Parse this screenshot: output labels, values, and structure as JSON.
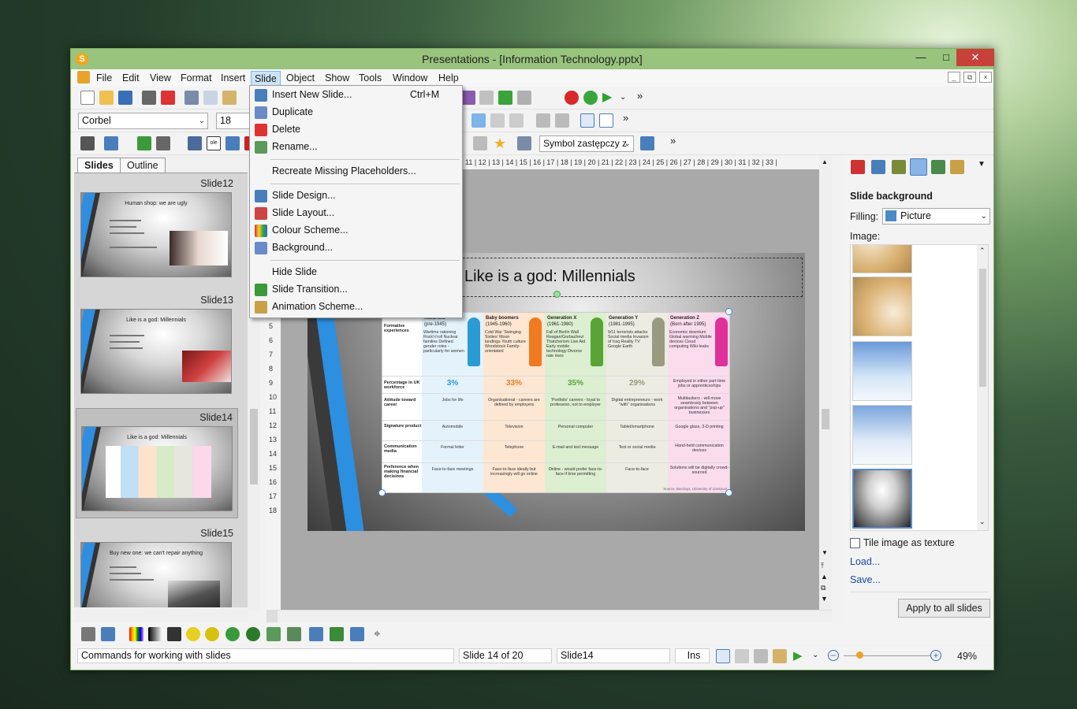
{
  "window": {
    "title": "Presentations - [Information Technology.pptx]",
    "app_badge": "S"
  },
  "menubar": {
    "items": [
      "File",
      "Edit",
      "View",
      "Format",
      "Insert",
      "Slide",
      "Object",
      "Show",
      "Tools",
      "Window",
      "Help"
    ],
    "active": "Slide"
  },
  "toolbar": {
    "font": "Corbel",
    "font_size": "18",
    "symbol_combo": "Symbol zastępczy z"
  },
  "slide_menu": {
    "items": [
      {
        "label": "Insert New Slide...",
        "shortcut": "Ctrl+M",
        "icon": "insert-slide-icon"
      },
      {
        "label": "Duplicate",
        "icon": "duplicate-icon"
      },
      {
        "label": "Delete",
        "icon": "delete-slide-icon"
      },
      {
        "label": "Rename...",
        "icon": "rename-icon"
      },
      {
        "label": "Recreate Missing Placeholders..."
      },
      {
        "label": "Slide Design...",
        "icon": "slide-design-icon"
      },
      {
        "label": "Slide Layout...",
        "icon": "slide-layout-icon"
      },
      {
        "label": "Colour Scheme...",
        "icon": "colour-scheme-icon"
      },
      {
        "label": "Background...",
        "icon": "background-icon"
      },
      {
        "label": "Hide Slide"
      },
      {
        "label": "Slide Transition...",
        "icon": "slide-transition-icon"
      },
      {
        "label": "Animation Scheme...",
        "icon": "animation-scheme-icon"
      }
    ]
  },
  "left_panel": {
    "tabs": [
      "Slides",
      "Outline"
    ],
    "slides": [
      {
        "label": "Slide12",
        "title": "Human shop: we are ugly"
      },
      {
        "label": "Slide13",
        "title": "Like is a god: Millennials"
      },
      {
        "label": "Slide14",
        "title": "Like is a god: Millennials"
      },
      {
        "label": "Slide15",
        "title": "Buy new one: we can't repair anything"
      }
    ]
  },
  "editor": {
    "ruler_top": "11 | 12 | 13 | 14 | 15 | 16 | 17 | 18 | 19 | 20 | 21 | 22 | 23 | 24 | 25 | 26 | 27 | 28 | 29 | 30 | 31 | 32 | 33 |",
    "ruler_left": [
      "5",
      "6",
      "7",
      "8",
      "9",
      "10",
      "11",
      "12",
      "13",
      "14",
      "15",
      "16",
      "17",
      "18"
    ],
    "slide_title": "Like is a god: Millennials",
    "infographic": {
      "generations": [
        {
          "name": "Maturists",
          "years": "(pre-1945)",
          "experiences": "Wartime rationing Rock'n'roll Nuclear families Defined gender roles - particularly for women",
          "pct": "3%",
          "attitude": "Jobs for life",
          "product": "Automobile",
          "media": "Formal letter",
          "finance": "Face-to-face meetings",
          "color": "#2b9bd6"
        },
        {
          "name": "Baby boomers",
          "years": "(1945-1960)",
          "experiences": "Cold War 'Swinging Sixties' Moon landings Youth culture Woodstock Family-orientated",
          "pct": "33%",
          "attitude": "Organisational - careers are defined by employers",
          "product": "Television",
          "media": "Telephone",
          "finance": "Face-to-face ideally but increasingly will go online",
          "color": "#f07a20"
        },
        {
          "name": "Generation X",
          "years": "(1961-1980)",
          "experiences": "Fall of Berlin Wall Reagan/Gorbachev/ Thatcherism Live Aid Early mobile technology Divorce rate rises",
          "pct": "35%",
          "attitude": "'Portfolio' careers - loyal to profession, not to employer",
          "product": "Personal computer",
          "media": "E-mail and text message",
          "finance": "Online - would prefer face-to-face if time permitting",
          "color": "#5aa335"
        },
        {
          "name": "Generation Y",
          "years": "(1981-1995)",
          "experiences": "9/11 terrorists attacks Social media Invasion of Iraq Reality TV Google Earth",
          "pct": "29%",
          "attitude": "Digital entrepreneurs - work \"with\" organisations",
          "product": "Tablet/smartphone",
          "media": "Text or social media",
          "finance": "Face-to-face",
          "color": "#9a9a80"
        },
        {
          "name": "Generation Z",
          "years": "(Born after 1995)",
          "experiences": "Economic downturn Global warming Mobile devices Cloud computing Wiki-leaks",
          "pct": "Employed in either part-time jobs or apprenticeships",
          "attitude": "Multitaskers - will move seamlessly between organisations and \"pop-up\" businesses",
          "product": "Google glass, 3-D printing",
          "media": "Hand-held communication devices",
          "finance": "Solutions will be digitally crowd-sourced",
          "color": "#e0309a"
        }
      ],
      "row_labels": [
        "Formative experiences",
        "Percentage in UK workforce",
        "Attitude toward career",
        "Signature product",
        "Communication media",
        "Preference when making financial decisions"
      ],
      "source": "Source: Barclays, University of Liverpool"
    }
  },
  "right_panel": {
    "heading": "Slide background",
    "filling_label": "Filling:",
    "filling_value": "Picture",
    "image_label": "Image:",
    "tile_label": "Tile image as texture",
    "load": "Load...",
    "save": "Save...",
    "apply_all": "Apply to all slides"
  },
  "statusbar": {
    "hint": "Commands for working with slides",
    "slide_of": "Slide 14 of 20",
    "slide_name": "Slide14",
    "mode": "Ins",
    "zoom": "49%"
  },
  "colors": {
    "titlebar": "#99c47d",
    "close": "#c7413a",
    "menu_active": "#cce4f7",
    "accent_blue": "#2c8fe0"
  }
}
